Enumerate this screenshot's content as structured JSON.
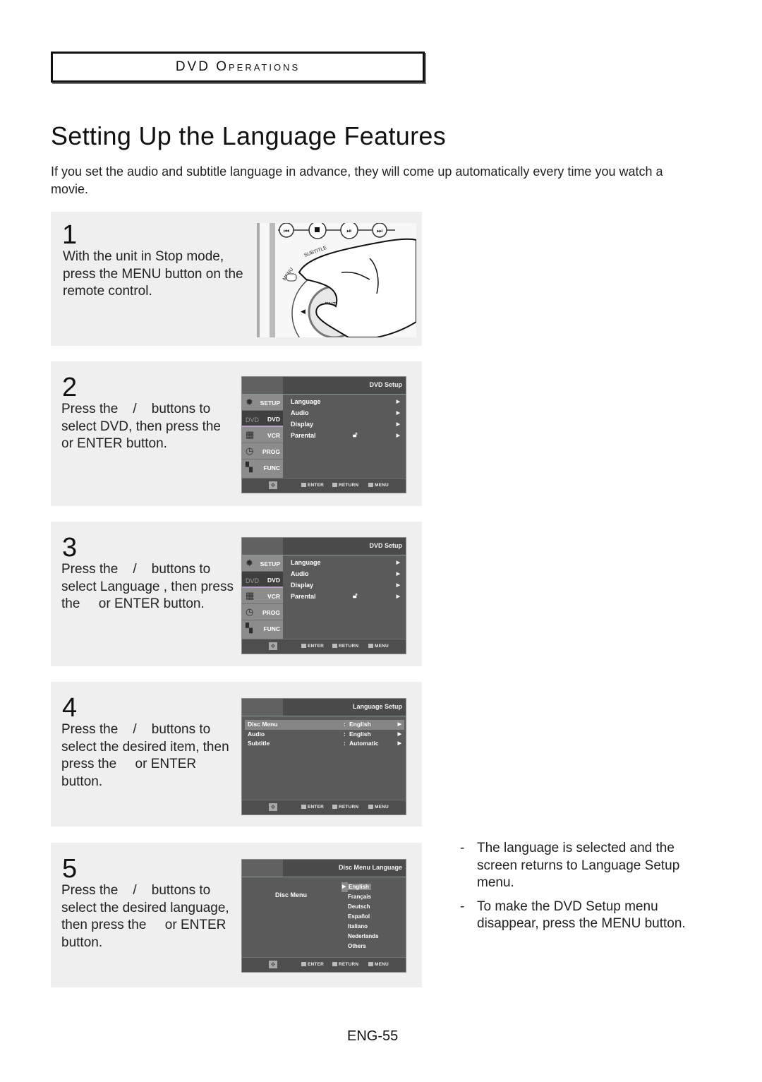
{
  "section_header": "DVD Operations",
  "page_title": "Setting Up the Language Features",
  "intro": "If you set the audio and subtitle language in advance, they will come up automatically every time you watch a movie.",
  "steps": [
    {
      "number": "1",
      "text": "With the unit in Stop mode, press the MENU button on the remote control.",
      "remote": {
        "subtitle_label": "SUBTITLE",
        "menu_label": "MENU",
        "enter_label": "ENTER"
      }
    },
    {
      "number": "2",
      "text_lines": [
        "Press the    /    buttons to",
        "select DVD, then press the",
        "or ENTER button."
      ],
      "osd": {
        "title": "DVD Setup",
        "side": [
          {
            "icon": "gear-icon",
            "glyph": "✹",
            "label": "SETUP"
          },
          {
            "icon": "dvd-disc-icon",
            "glyph": "DVD",
            "label": "DVD",
            "active": true
          },
          {
            "icon": "vcr-icon",
            "glyph": "▦",
            "label": "VCR"
          },
          {
            "icon": "clock-icon",
            "glyph": "◷",
            "label": "PROG"
          },
          {
            "icon": "function-icon",
            "glyph": "▚",
            "label": "FUNC"
          }
        ],
        "items": [
          "Language",
          "Audio",
          "Display",
          "Parental"
        ],
        "footer": {
          "enter": "ENTER",
          "return": "RETURN",
          "menu": "MENU"
        }
      }
    },
    {
      "number": "3",
      "text_lines": [
        "Press the    /    buttons to",
        "select Language , then press",
        "the     or ENTER button."
      ],
      "osd": {
        "title": "DVD Setup",
        "items": [
          "Language",
          "Audio",
          "Display",
          "Parental"
        ],
        "footer": {
          "enter": "ENTER",
          "return": "RETURN",
          "menu": "MENU"
        }
      }
    },
    {
      "number": "4",
      "text_lines": [
        "Press the    /    buttons to",
        "select the desired item, then",
        "press the     or ENTER",
        "button."
      ],
      "osd": {
        "title": "Language Setup",
        "rows": [
          {
            "label": "Disc Menu",
            "value": "English",
            "highlighted": true
          },
          {
            "label": "Audio",
            "value": "English"
          },
          {
            "label": "Subtitle",
            "value": "Automatic"
          }
        ],
        "footer": {
          "enter": "ENTER",
          "return": "RETURN",
          "menu": "MENU"
        }
      }
    },
    {
      "number": "5",
      "text_lines": [
        "Press the    /    buttons to",
        "select the desired language,",
        "then press the     or ENTER",
        "button."
      ],
      "osd": {
        "title": "Disc Menu Language",
        "label": "Disc Menu",
        "languages": [
          "English",
          "Français",
          "Deutsch",
          "Español",
          "Italiano",
          "Nederlands",
          "Others"
        ],
        "selected": "English",
        "footer": {
          "enter": "ENTER",
          "return": "RETURN",
          "menu": "MENU"
        }
      }
    }
  ],
  "notes": [
    "The language is selected and the screen returns to Language Setup menu.",
    "To make the DVD Setup menu disappear, press the MENU button."
  ],
  "page_number": "ENG-55"
}
